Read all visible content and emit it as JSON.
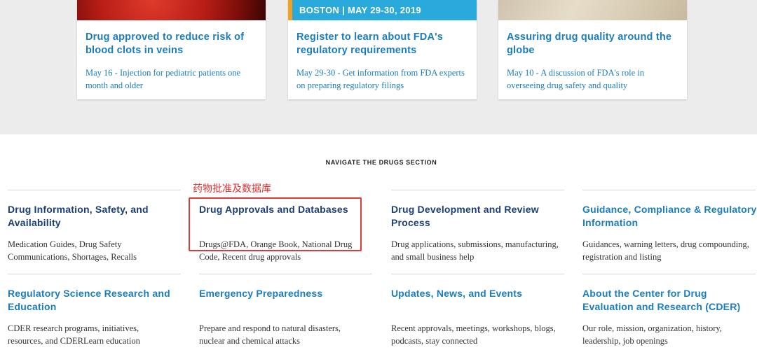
{
  "colors": {
    "band_background": "#ececec",
    "link_blue": "#1a7dbf",
    "navy_title": "#1c3f73",
    "highlight_red": "#e03a36"
  },
  "cards": [
    {
      "image": "blood-clot-image",
      "banner": "",
      "title": "Drug approved to reduce risk of blood clots in veins",
      "desc": "May 16 - Injection for pediatric patients one month and older"
    },
    {
      "image": "event-banner-image",
      "banner": "BOSTON | MAY 29-30, 2019",
      "title": "Register to learn about FDA's regulatory requirements",
      "desc": "May 29-30 - Get information from FDA experts on preparing regulatory filings"
    },
    {
      "image": "pills-image",
      "banner": "",
      "title": "Assuring drug quality around the globe",
      "desc": "May 10 - A discussion of FDA's role in overseeing drug safety and quality"
    }
  ],
  "navigate": {
    "heading": "NAVIGATE THE DRUGS SECTION",
    "annotation": "药物批准及数据库",
    "items": [
      {
        "title": "Drug Information, Safety, and Availability",
        "desc": "Medication Guides, Drug Safety Communications, Shortages, Recalls",
        "title_color": "#1c3f73"
      },
      {
        "title": "Drug Approvals and Databases",
        "desc": "Drugs@FDA, Orange Book, National Drug Code, Recent drug approvals",
        "title_color": "#1c3f73"
      },
      {
        "title": "Drug Development and Review Process",
        "desc": "Drug applications, submissions, manufacturing, and small business help",
        "title_color": "#1c3f73"
      },
      {
        "title": "Guidance, Compliance & Regulatory Information",
        "desc": "Guidances, warning letters, drug compounding, registration and listing",
        "title_color": "#1a7dbf"
      },
      {
        "title": "Regulatory Science Research and Education",
        "desc": "CDER research programs, initiatives, resources, and CDERLearn education",
        "title_color": "#1a7dbf"
      },
      {
        "title": "Emergency Preparedness",
        "desc": "Prepare and respond to natural disasters, nuclear and chemical attacks",
        "title_color": "#1a7dbf"
      },
      {
        "title": "Updates, News, and Events",
        "desc": "Recent approvals, meetings, workshops, blogs, podcasts, stay connected",
        "title_color": "#1a7dbf"
      },
      {
        "title": "About the Center for Drug Evaluation and Research (CDER)",
        "desc": "Our role, mission, organization, history, leadership, job openings",
        "title_color": "#1a7dbf"
      }
    ]
  }
}
